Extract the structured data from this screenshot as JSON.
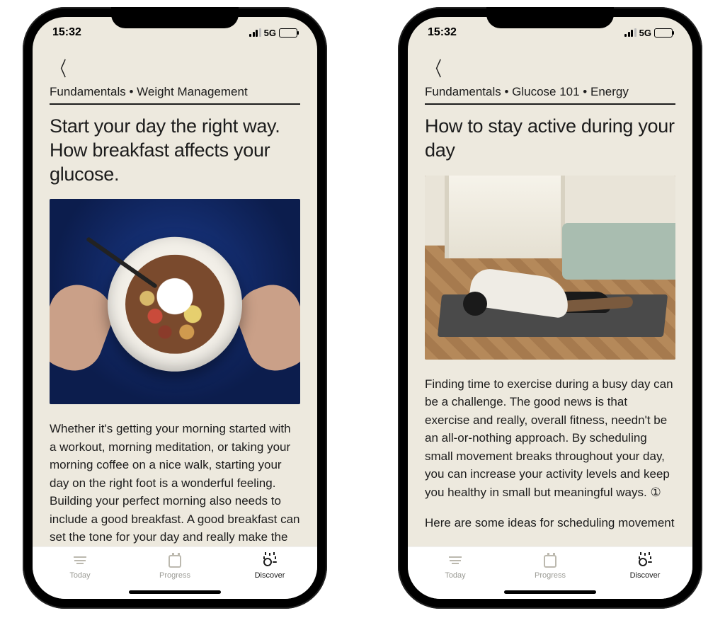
{
  "status": {
    "time": "15:32",
    "network": "5G"
  },
  "tabs": {
    "today": "Today",
    "progress": "Progress",
    "discover": "Discover"
  },
  "phones": [
    {
      "breadcrumb": "Fundamentals • Weight Management",
      "title": "Start your day the right way. How breakfast affects your glucose.",
      "body1": "Whether it's getting your morning started with a workout, morning meditation, or taking your morning coffee on a nice walk, starting your day on the right foot is a wonderful feeling. Building your perfect morning also needs to include a good breakfast. A good breakfast can set the tone for your day and really make the difference"
    },
    {
      "breadcrumb": "Fundamentals • Glucose 101 • Energy",
      "title": "How to stay active during your day",
      "body1": "Finding time to exercise during a busy day can be a challenge. The good news is that exercise and really, overall fitness, needn't be an all-or-nothing approach. By scheduling small movement breaks throughout your day, you can increase your activity levels and keep you healthy in small but meaningful ways. ①",
      "body2": "Here are some ideas for scheduling movement"
    }
  ]
}
